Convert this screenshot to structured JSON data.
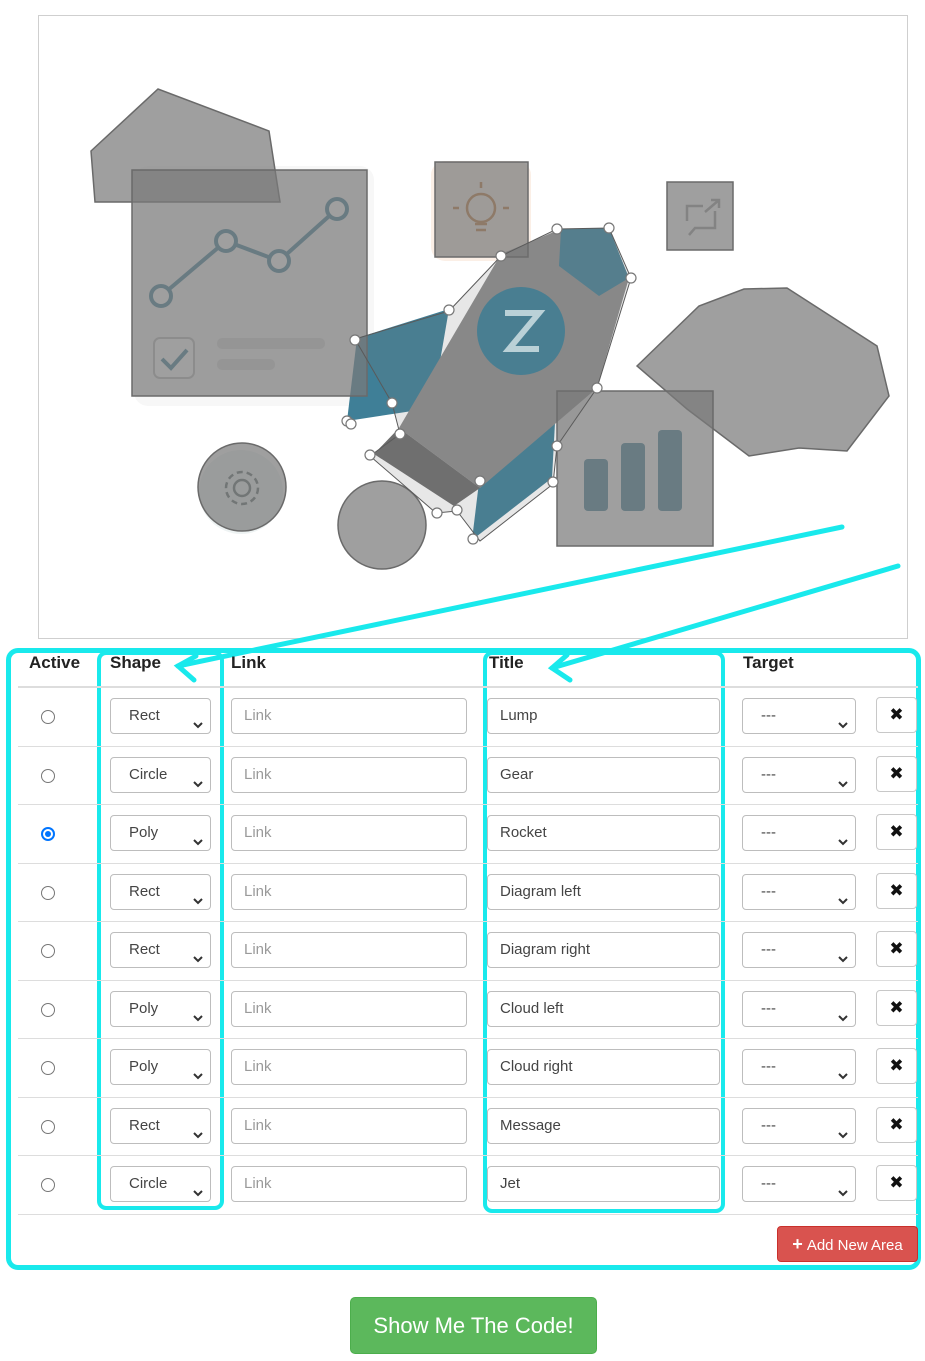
{
  "table": {
    "headers": {
      "active": "Active",
      "shape": "Shape",
      "link": "Link",
      "title": "Title",
      "target": "Target"
    },
    "link_placeholder": "Link",
    "delete_glyph": "✖",
    "rows": [
      {
        "active": false,
        "shape": "Rect",
        "link": "",
        "title": "Lump",
        "target": "---"
      },
      {
        "active": false,
        "shape": "Circle",
        "link": "",
        "title": "Gear",
        "target": "---"
      },
      {
        "active": true,
        "shape": "Poly",
        "link": "",
        "title": "Rocket",
        "target": "---"
      },
      {
        "active": false,
        "shape": "Rect",
        "link": "",
        "title": "Diagram left",
        "target": "---"
      },
      {
        "active": false,
        "shape": "Rect",
        "link": "",
        "title": "Diagram right",
        "target": "---"
      },
      {
        "active": false,
        "shape": "Poly",
        "link": "",
        "title": "Cloud left",
        "target": "---"
      },
      {
        "active": false,
        "shape": "Poly",
        "link": "",
        "title": "Cloud right",
        "target": "---"
      },
      {
        "active": false,
        "shape": "Rect",
        "link": "",
        "title": "Message",
        "target": "---"
      },
      {
        "active": false,
        "shape": "Circle",
        "link": "",
        "title": "Jet",
        "target": "---"
      }
    ]
  },
  "buttons": {
    "add_label": "Add New Area",
    "add_icon": "+",
    "show_code_label": "Show Me The Code!"
  },
  "colors": {
    "highlight": "#19e9ec",
    "danger": "#d9534f",
    "success": "#5cb85c",
    "area_overlay": "#7a7a7a",
    "rocket": "#3f7f97"
  },
  "icons": [
    "chevron-down-icon",
    "close-icon",
    "plus-icon",
    "bulb-icon",
    "gear-icon",
    "share-icon",
    "check-icon",
    "z-logo-icon"
  ]
}
